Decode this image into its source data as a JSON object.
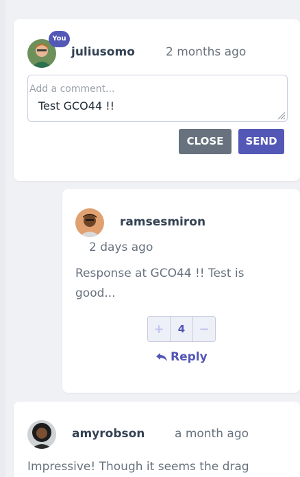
{
  "edit_card": {
    "user": {
      "name": "juliusomo",
      "badge": "You",
      "time": "2 months ago"
    },
    "input": {
      "placeholder": "Add a comment...",
      "value": "Test GCO44 !!"
    },
    "buttons": {
      "close": "CLOSE",
      "send": "SEND"
    }
  },
  "reply_card": {
    "user": {
      "name": "ramsesmiron",
      "time": "2 days ago"
    },
    "text_line1": "Response at GCO44 !! Test is",
    "text_line2": "good...",
    "score": {
      "plus": "+",
      "value": "4",
      "minus": "−"
    },
    "reply_label": "Reply"
  },
  "next_card": {
    "user": {
      "name": "amyrobson",
      "time": "a month ago"
    },
    "text_line1": "Impressive! Though it seems the drag"
  },
  "colors": {
    "accent": "#5357b6",
    "neutral_button": "#67727e",
    "username": "#334253",
    "body_text": "#67727e"
  },
  "icons": [
    "reply-arrow-icon",
    "resize-grip-icon"
  ]
}
